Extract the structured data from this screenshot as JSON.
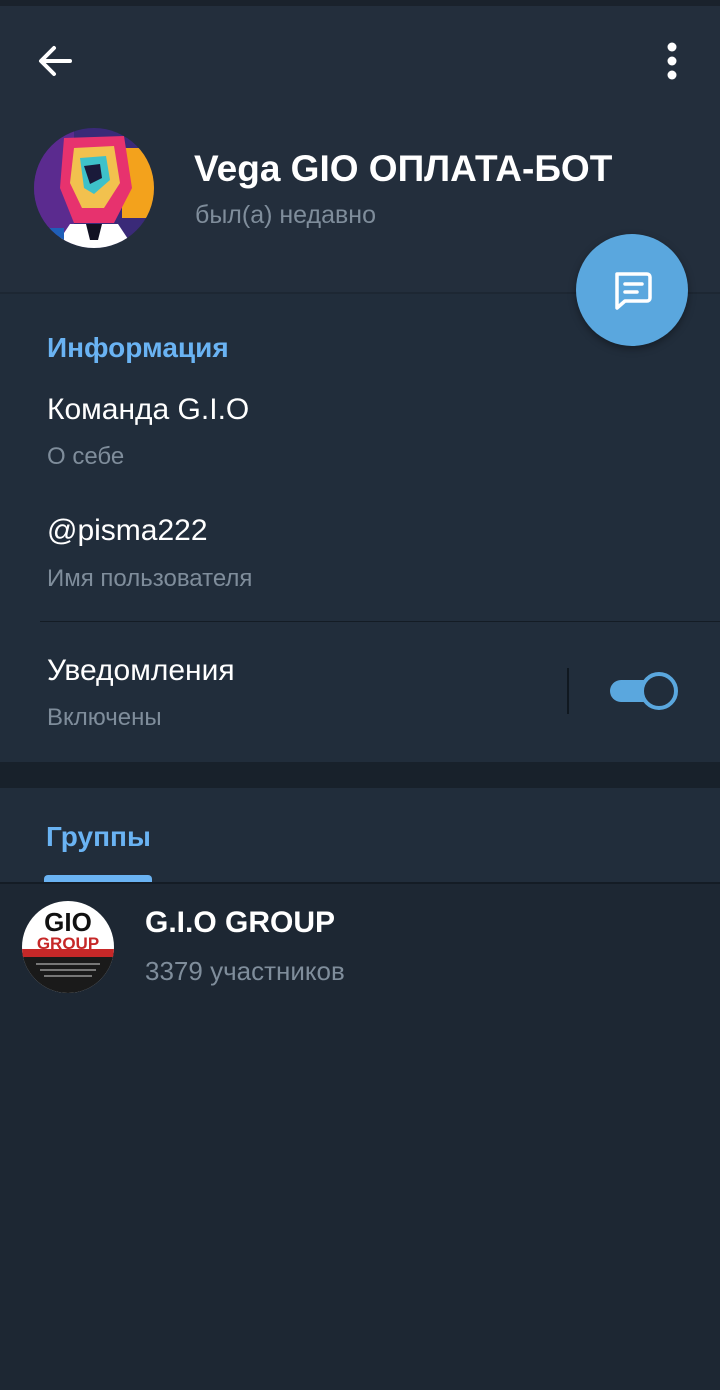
{
  "profile": {
    "name": "Vega GIO ОПЛАТА-БОТ",
    "status": "был(а) недавно",
    "avatar_icon": "avatar-portrait-icon"
  },
  "toolbar": {
    "back_icon": "arrow-left-icon",
    "menu_icon": "more-vertical-icon"
  },
  "fab": {
    "icon": "message-icon"
  },
  "info": {
    "title": "Информация",
    "bio": {
      "value": "Команда G.I.O",
      "label": "О себе"
    },
    "username": {
      "value": "@pisma222",
      "label": "Имя пользователя"
    },
    "notifications": {
      "value": "Уведомления",
      "label": "Включены",
      "enabled": true
    }
  },
  "groups": {
    "tab_label": "Группы",
    "items": [
      {
        "name": "G.I.O GROUP",
        "members": "3379 участников",
        "avatar_text_1": "GIO",
        "avatar_text_2": "GROUP"
      }
    ]
  },
  "colors": {
    "accent": "#5aa7de",
    "section_title": "#6ab3f3",
    "background": "#1d2733",
    "header": "#232e3c"
  }
}
